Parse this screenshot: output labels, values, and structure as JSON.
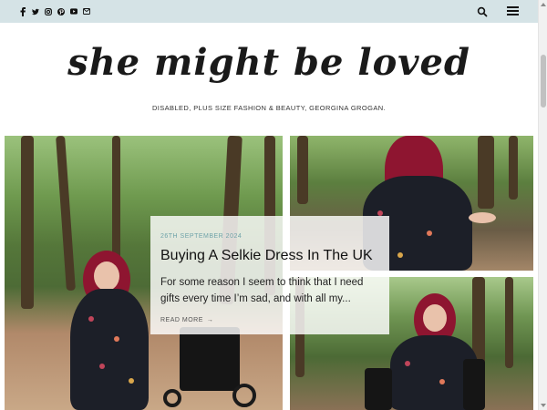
{
  "topbar": {
    "social_icons": [
      "facebook-icon",
      "twitter-icon",
      "instagram-icon",
      "pinterest-icon",
      "youtube-icon",
      "email-icon"
    ],
    "social_glyphs": [
      "f",
      "t",
      "◎",
      "℗",
      "▶",
      "✉"
    ],
    "search_icon": "search-icon",
    "menu_icon": "hamburger-menu-icon"
  },
  "header": {
    "logo": "she might be loved",
    "tagline": "DISABLED, PLUS SIZE FASHION & BEAUTY, GEORGINA GROGAN."
  },
  "featured_post": {
    "date": "26TH SEPTEMBER 2024",
    "title": "Buying A Selkie Dress In The UK",
    "excerpt": "For some reason I seem to think that I need gifts every time I’m sad, and with all my...",
    "read_more": "READ MORE",
    "read_more_arrow": "→"
  },
  "colors": {
    "topbar_bg": "#d5e3e6",
    "date_accent": "#6fa3a9",
    "text": "#111111"
  }
}
